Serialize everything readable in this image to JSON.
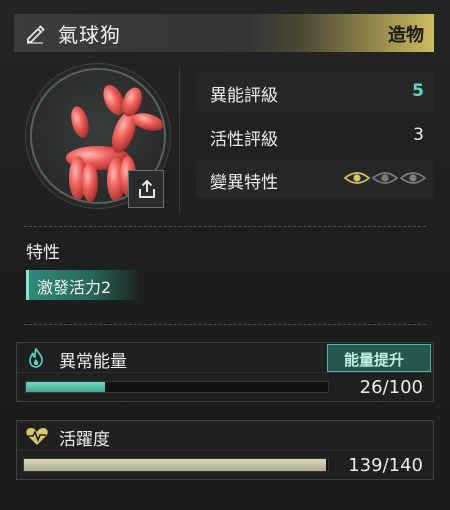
{
  "header": {
    "title": "氣球狗",
    "type_label": "造物",
    "edit_icon": "pencil-icon"
  },
  "portrait": {
    "subject": "balloon-dog",
    "export_icon": "export-icon"
  },
  "stats": [
    {
      "label": "異能評級",
      "value": "5"
    },
    {
      "label": "活性評級",
      "value": "3"
    },
    {
      "label": "變異特性",
      "eyes_active": 1,
      "eyes_total": 3
    }
  ],
  "traits": {
    "label": "特性",
    "items": [
      "激發活力2"
    ]
  },
  "energy": {
    "label": "異常能量",
    "icon": "flame-icon",
    "boost_label": "能量提升",
    "current": 26,
    "max": 100,
    "display": "26/100"
  },
  "activity": {
    "label": "活躍度",
    "icon": "heart-pulse-icon",
    "current": 139,
    "max": 140,
    "display": "139/140"
  },
  "colors": {
    "accent": "#5fd9c2",
    "gold": "#cdbb5e",
    "energy_bar": "#5fc9ae",
    "activity_bar": "#cfcdb0"
  }
}
